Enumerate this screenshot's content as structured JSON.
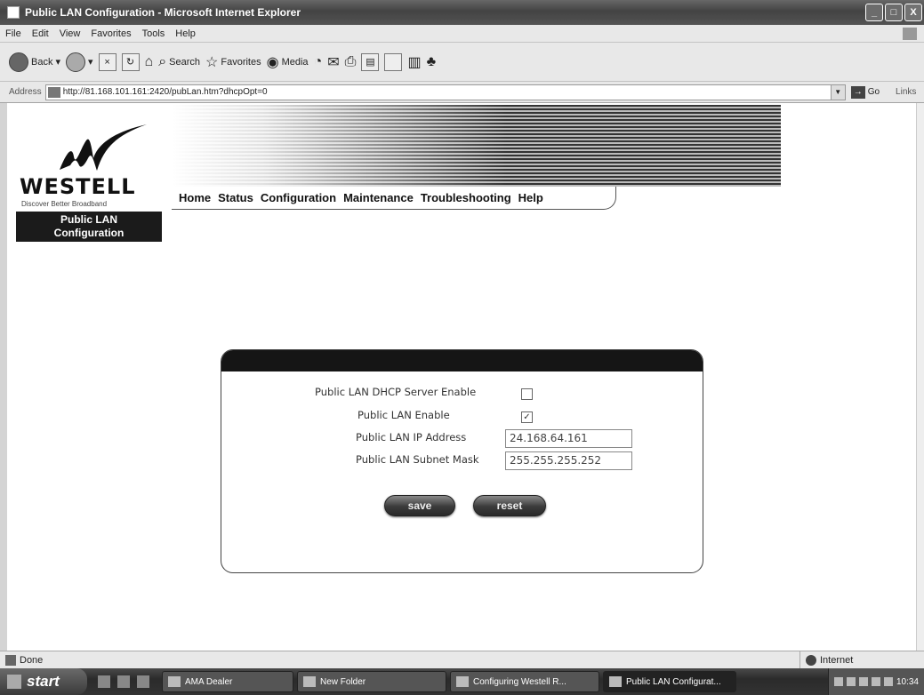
{
  "window": {
    "title": "Public LAN Configuration - Microsoft Internet Explorer",
    "buttons": [
      "_",
      "□",
      "X"
    ]
  },
  "menu": [
    "File",
    "Edit",
    "View",
    "Favorites",
    "Tools",
    "Help"
  ],
  "toolbar": {
    "back": "Back",
    "search": "Search",
    "favorites": "Favorites",
    "media": "Media"
  },
  "address": {
    "label": "Address",
    "url": "http://81.168.101.161:2420/pubLan.htm?dhcpOpt=0",
    "go": "Go",
    "links": "Links"
  },
  "page": {
    "brand": "WESTELL",
    "tagline": "Discover Better Broadband",
    "nav": [
      "Home",
      "Status",
      "Configuration",
      "Maintenance",
      "Troubleshooting",
      "Help"
    ],
    "section_label_line1": "Public LAN",
    "section_label_line2": "Configuration",
    "form": {
      "dhcp_label": "Public LAN DHCP Server Enable",
      "dhcp_checked": false,
      "lan_enable_label": "Public LAN Enable",
      "lan_enable_checked": true,
      "lan_enable_mark": "✓",
      "ip_label": "Public LAN IP Address",
      "ip_value": "24.168.64.161",
      "mask_label": "Public LAN Subnet Mask",
      "mask_value": "255.255.255.252",
      "save": "save",
      "reset": "reset"
    }
  },
  "status": {
    "text": "Done",
    "zone": "Internet"
  },
  "taskbar": {
    "start": "start",
    "tasks": [
      "AMA Dealer",
      "New Folder",
      "Configuring Westell R...",
      "Public LAN Configurat..."
    ],
    "clock": "10:34"
  }
}
